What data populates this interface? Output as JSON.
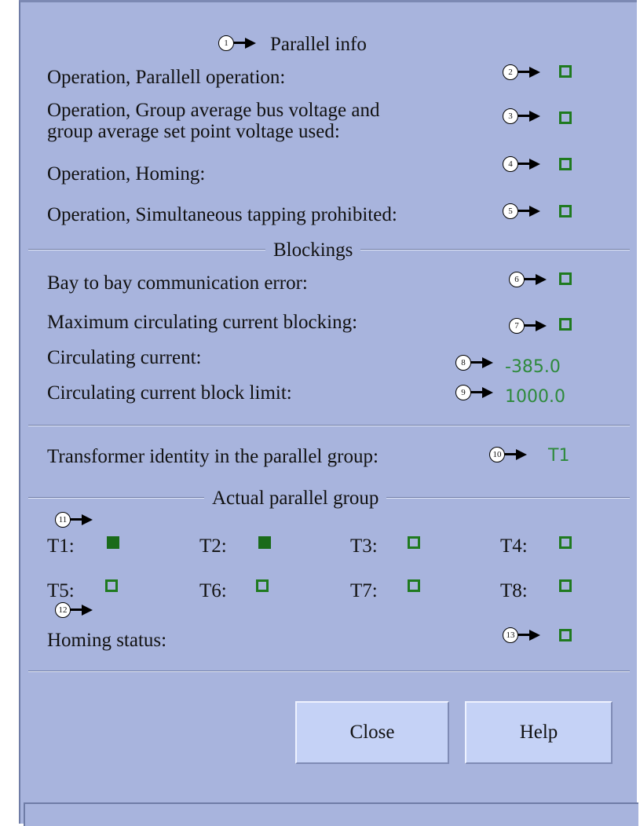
{
  "sections": {
    "parallel_info": "Parallel info",
    "blockings": "Blockings",
    "actual_parallel_group": "Actual parallel group"
  },
  "rows": {
    "parallel_operation": "Operation, Parallell operation:",
    "group_average_line1": "Operation, Group average bus voltage and",
    "group_average_line2": "group average set point voltage used:",
    "homing": "Operation, Homing:",
    "simultaneous_tapping": "Operation, Simultaneous tapping prohibited:",
    "bay_to_bay": "Bay to bay communication error:",
    "max_circulating_block": "Maximum circulating current blocking:",
    "circulating_current": "Circulating current:",
    "circulating_limit": "Circulating current block limit:",
    "transformer_identity": "Transformer identity in the parallel group:",
    "homing_status": "Homing status:"
  },
  "values": {
    "circulating_current": "-385.0",
    "circulating_limit": "1000.0",
    "transformer_identity": "T1"
  },
  "indicators": {
    "parallel_operation": false,
    "group_average": false,
    "homing": false,
    "simultaneous_tapping": false,
    "bay_to_bay": false,
    "max_circulating_block": false,
    "homing_status": false
  },
  "group": [
    {
      "label": "T1:",
      "active": true
    },
    {
      "label": "T2:",
      "active": true
    },
    {
      "label": "T3:",
      "active": false
    },
    {
      "label": "T4:",
      "active": false
    },
    {
      "label": "T5:",
      "active": false
    },
    {
      "label": "T6:",
      "active": false
    },
    {
      "label": "T7:",
      "active": false
    },
    {
      "label": "T8:",
      "active": false
    }
  ],
  "callouts": [
    "1",
    "2",
    "3",
    "4",
    "5",
    "6",
    "7",
    "8",
    "9",
    "10",
    "11",
    "12",
    "13"
  ],
  "buttons": {
    "close": "Close",
    "help": "Help"
  },
  "colors": {
    "panel": "#a8b4dd",
    "indicator_green": "#1f7a1f",
    "value_green": "#2e8a3c",
    "button": "#c5d2f6"
  }
}
